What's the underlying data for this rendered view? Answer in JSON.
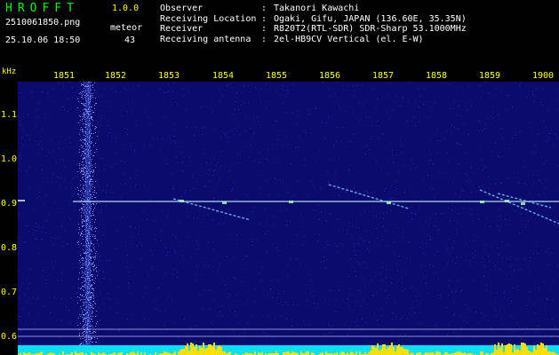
{
  "app": {
    "title": "HROFFT",
    "version": "1.0.0",
    "filename": "2510061850.png",
    "datetime": "25.10.06 18:50",
    "meteor_label": "meteor",
    "meteor_count": "43"
  },
  "station_info": [
    {
      "key": "Observer",
      "sep": ":",
      "value": "Takanori Kawachi"
    },
    {
      "key": "Receiving Location",
      "sep": ":",
      "value": "Ogaki, Gifu, JAPAN (136.60E, 35.35N)"
    },
    {
      "key": "Receiver",
      "sep": ":",
      "value": "R820T2(RTL-SDR) SDR-Sharp 53.1000MHz"
    },
    {
      "key": "Receiving antenna",
      "sep": ":",
      "value": "2el-HB9CV Vertical (el. E-W)"
    }
  ],
  "spectrogram": {
    "y_unit": "kHz",
    "x_ticks": [
      "1851",
      "1852",
      "1853",
      "1854",
      "1855",
      "1856",
      "1857",
      "1858",
      "1859",
      "1900"
    ],
    "y_ticks": [
      "1.1",
      "1.0",
      "0.9",
      "0.8",
      "0.7",
      "0.6"
    ],
    "colors": {
      "background": "#0b0b6e",
      "noise": "#2a3cff",
      "signal": "#c8f0ff",
      "axis_text": "#ffff00",
      "title_text": "#00ff00",
      "bottom_fill": "#00e0ff",
      "bottom_spikes": "#ffe000"
    }
  }
}
